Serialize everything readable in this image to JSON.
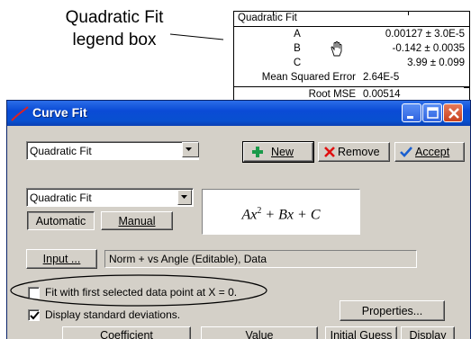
{
  "annotation": {
    "line1": "Quadratic Fit",
    "line2": "legend box"
  },
  "legend": {
    "title": "Quadratic Fit",
    "rows": [
      {
        "label": "A",
        "value": "0.00127 ± 3.0E-5"
      },
      {
        "label": "B",
        "value": "-0.142 ± 0.0035"
      },
      {
        "label": "C",
        "value": "3.99 ±  0.099"
      }
    ],
    "mse_label": "Mean Squared Error",
    "mse_value": "2.64E-5",
    "rmse_label": "Root MSE",
    "rmse_value": "0.00514",
    "cursor_icon": "hand-cursor-icon"
  },
  "window": {
    "title": "Curve Fit",
    "icon": "curve-fit-icon",
    "buttons": {
      "minimize": "minimize-icon",
      "maximize": "maximize-icon",
      "close": "close-icon"
    }
  },
  "fit": {
    "primary_select": "Quadratic Fit",
    "secondary_select": "Quadratic Fit",
    "modes": {
      "automatic": "Automatic",
      "manual": "Manual"
    },
    "active_mode": "Automatic",
    "formula": {
      "term1": "Ax",
      "exp": "2",
      "rest": " + Bx + C"
    }
  },
  "actions": {
    "new_label": "New",
    "remove_label": "Remove",
    "accept_label": "Accept"
  },
  "input": {
    "button_label": "Input ...",
    "value": "Norm + vs Angle (Editable), Data"
  },
  "options": {
    "fit_first_point": {
      "label": "Fit with first selected data point at X = 0.",
      "checked": false
    },
    "display_std": {
      "label": "Display standard deviations.",
      "checked": true
    }
  },
  "properties_label": "Properties...",
  "table": {
    "headers": [
      "Coefficient",
      "Value",
      "Initial Guess",
      "Display"
    ]
  },
  "colors": {
    "titlebar": "#0a4bd6",
    "face": "#d4d0c8",
    "new_plus": "#1a9a4a",
    "remove_x": "#e01010",
    "accept_check": "#1a5fd0"
  }
}
